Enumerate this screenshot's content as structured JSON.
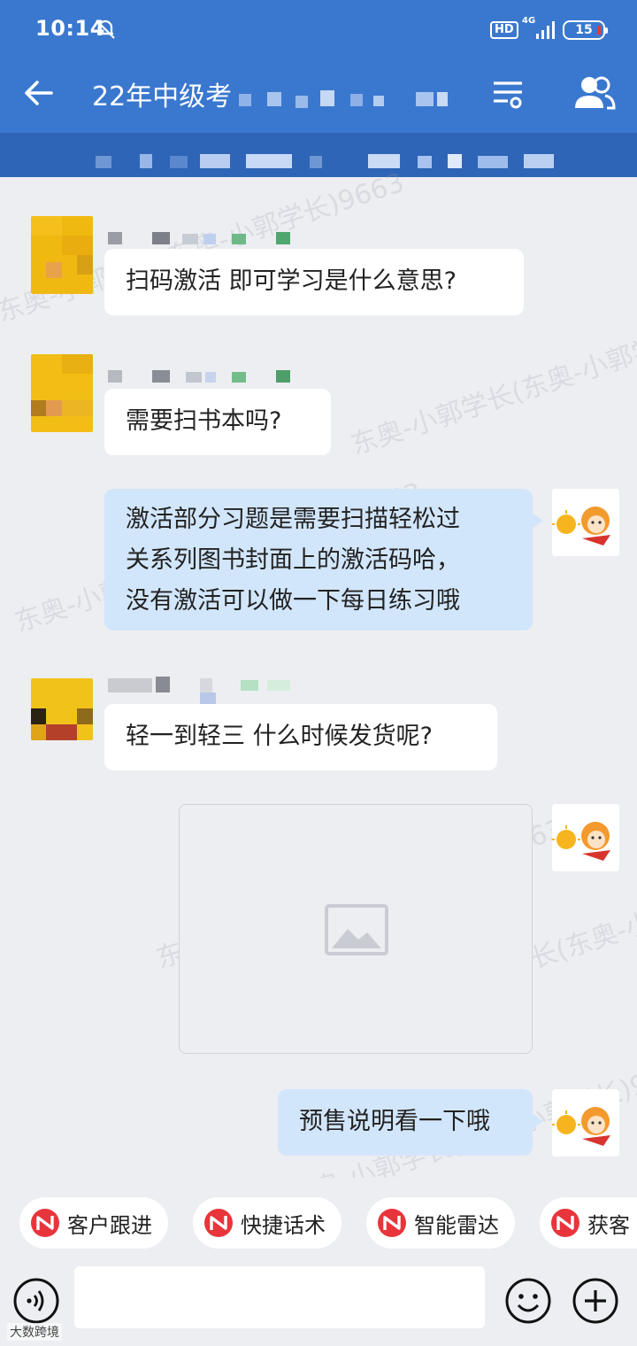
{
  "status_bar": {
    "time": "10:14",
    "hd_label": "HD",
    "network": "4G",
    "battery": "15"
  },
  "header": {
    "title": "22年中级考"
  },
  "messages": [
    {
      "direction": "incoming",
      "text": "扫码激活 即可学习是什么意思?"
    },
    {
      "direction": "incoming",
      "text": "需要扫书本吗?"
    },
    {
      "direction": "outgoing",
      "lines": [
        "激活部分习题是需要扫描轻松过",
        "关系列图书封面上的激活码哈，",
        "没有激活可以做一下每日练习哦"
      ]
    },
    {
      "direction": "incoming",
      "text": "轻一到轻三 什么时候发货呢?"
    },
    {
      "direction": "outgoing",
      "type": "image"
    },
    {
      "direction": "outgoing",
      "text": "预售说明看一下哦"
    }
  ],
  "watermark_text": "东奥-小郭学长(东奥-小郭学长)9663",
  "quick_actions": [
    "客户跟进",
    "快捷话术",
    "智能雷达",
    "获客"
  ],
  "corner_mark": "大数跨境",
  "colors": {
    "header_blue": "#3A78CF",
    "outgoing_bubble": "#D2E6FB",
    "quick_icon_red": "#E8353B"
  }
}
